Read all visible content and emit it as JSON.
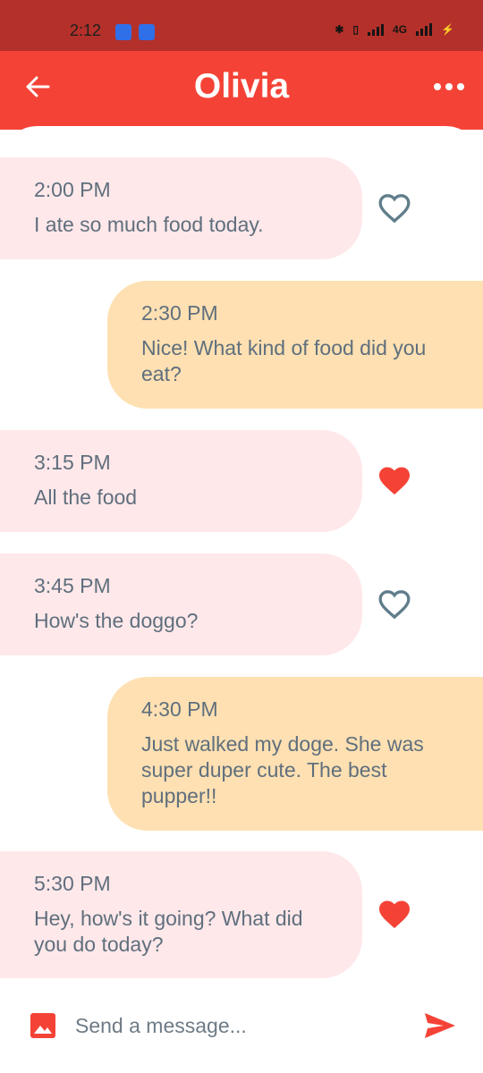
{
  "status_bar": {
    "time": "2:12",
    "network": "4G"
  },
  "header": {
    "title": "Olivia",
    "back_icon": "back-arrow-icon",
    "menu_icon": "more-horizontal-icon",
    "color": "#f44336"
  },
  "messages": [
    {
      "direction": "received",
      "time": "2:00 PM",
      "text": "I ate so much food today.",
      "liked": false
    },
    {
      "direction": "sent",
      "time": "2:30 PM",
      "text": "Nice! What kind of food did you eat?"
    },
    {
      "direction": "received",
      "time": "3:15 PM",
      "text": "All the food",
      "liked": true
    },
    {
      "direction": "received",
      "time": "3:45 PM",
      "text": "How's the doggo?",
      "liked": false
    },
    {
      "direction": "sent",
      "time": "4:30 PM",
      "text": "Just walked my doge. She was super duper cute. The best pupper!!"
    },
    {
      "direction": "received",
      "time": "5:30 PM",
      "text": "Hey, how's it going? What did you do today?",
      "liked": true
    }
  ],
  "composer": {
    "placeholder": "Send a message...",
    "image_icon": "image-icon",
    "send_icon": "send-icon"
  },
  "colors": {
    "received_bubble": "#ffe8ea",
    "sent_bubble": "#fee0b2",
    "text": "#5f6f7d",
    "liked_heart": "#f44336",
    "unliked_heart": "#607d8b"
  }
}
